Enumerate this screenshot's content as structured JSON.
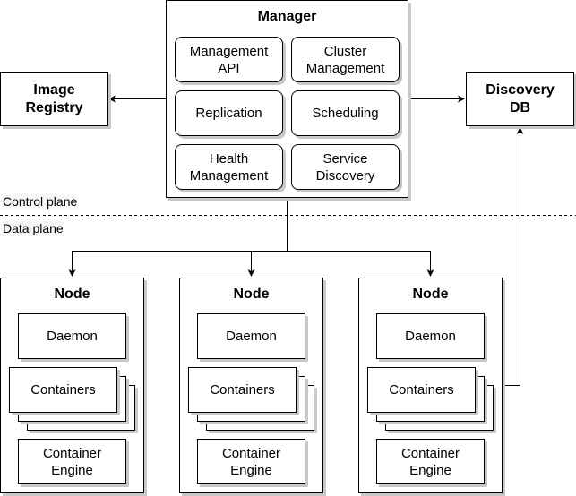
{
  "manager": {
    "title": "Manager",
    "components": [
      {
        "label_line1": "Management",
        "label_line2": "API"
      },
      {
        "label_line1": "Cluster",
        "label_line2": "Management"
      },
      {
        "label_line1": "Replication",
        "label_line2": ""
      },
      {
        "label_line1": "Scheduling",
        "label_line2": ""
      },
      {
        "label_line1": "Health",
        "label_line2": "Management"
      },
      {
        "label_line1": "Service",
        "label_line2": "Discovery"
      }
    ]
  },
  "image_registry": {
    "line1": "Image",
    "line2": "Registry"
  },
  "discovery_db": {
    "line1": "Discovery",
    "line2": "DB"
  },
  "planes": {
    "control": "Control plane",
    "data": "Data plane"
  },
  "nodes": [
    {
      "title": "Node",
      "daemon": "Daemon",
      "containers": "Containers",
      "engine_line1": "Container",
      "engine_line2": "Engine"
    },
    {
      "title": "Node",
      "daemon": "Daemon",
      "containers": "Containers",
      "engine_line1": "Container",
      "engine_line2": "Engine"
    },
    {
      "title": "Node",
      "daemon": "Daemon",
      "containers": "Containers",
      "engine_line1": "Container",
      "engine_line2": "Engine"
    }
  ],
  "colors": {
    "stroke": "#000000",
    "shadow": "#c8c8c8",
    "fill": "#ffffff"
  }
}
